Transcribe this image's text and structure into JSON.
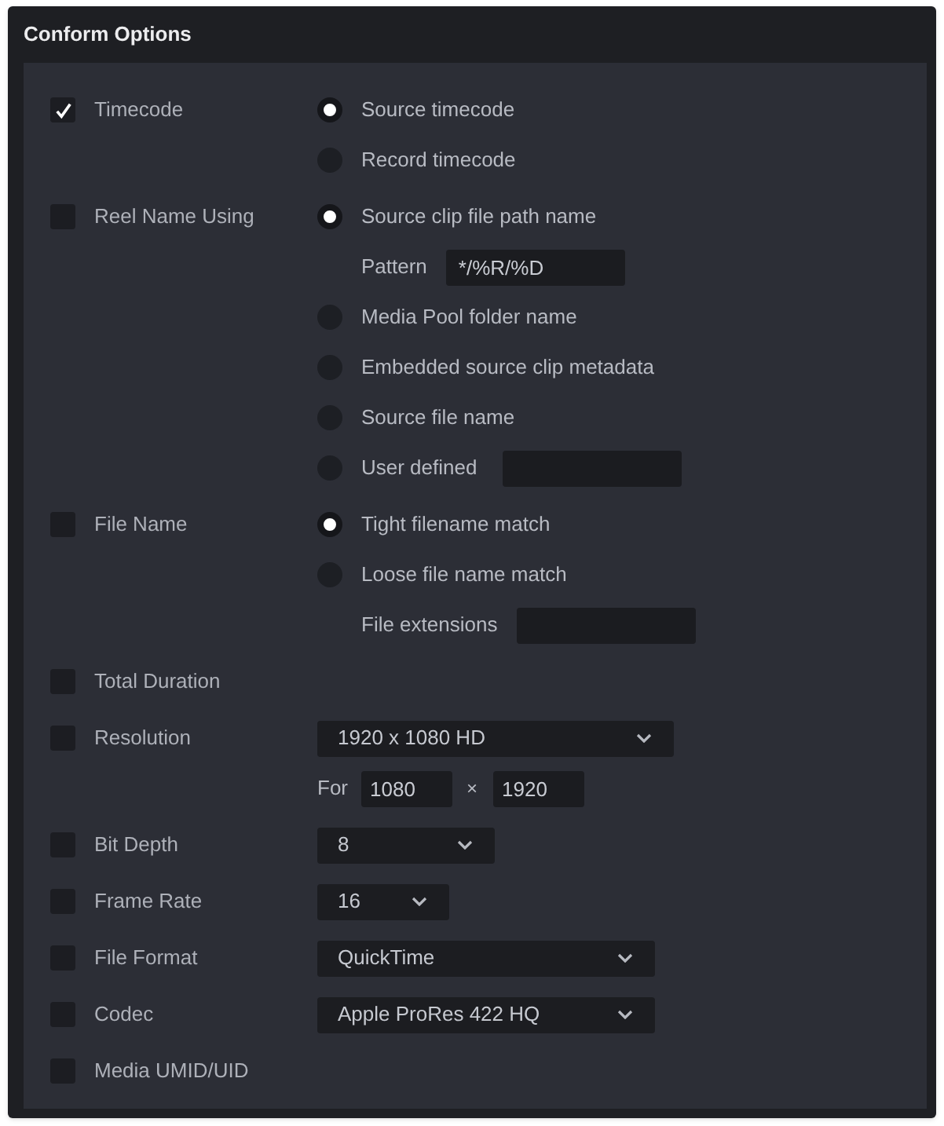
{
  "window": {
    "title": "Conform Options"
  },
  "options": [
    {
      "label": "Timecode",
      "checked": true,
      "controls": [
        {
          "kind": "radio",
          "label": "Source timecode",
          "selected": true
        },
        {
          "kind": "radio",
          "label": "Record timecode",
          "selected": false
        }
      ]
    },
    {
      "label": "Reel Name Using",
      "checked": false,
      "controls": [
        {
          "kind": "radio",
          "label": "Source clip file path name",
          "selected": true
        },
        {
          "kind": "text_field",
          "label": "Pattern",
          "value": "*/%R/%D"
        },
        {
          "kind": "radio",
          "label": "Media Pool folder name",
          "selected": false
        },
        {
          "kind": "radio",
          "label": "Embedded source clip metadata",
          "selected": false
        },
        {
          "kind": "radio",
          "label": "Source file name",
          "selected": false
        },
        {
          "kind": "radio_field",
          "label": "User defined",
          "selected": false
        }
      ]
    },
    {
      "label": "File Name",
      "checked": false,
      "controls": [
        {
          "kind": "radio",
          "label": "Tight filename match",
          "selected": true
        },
        {
          "kind": "radio",
          "label": "Loose file name match",
          "selected": false
        },
        {
          "kind": "text_field",
          "label": "File extensions"
        }
      ]
    },
    {
      "label": "Total Duration",
      "checked": false
    },
    {
      "label": "Resolution",
      "checked": false,
      "controls": [
        {
          "kind": "dropdown",
          "value": "1920 x 1080 HD"
        },
        {
          "kind": "size_fields",
          "label": "For",
          "values": [
            "1080",
            "1920"
          ],
          "separator": "×"
        }
      ]
    },
    {
      "label": "Bit Depth",
      "checked": false,
      "controls": [
        {
          "kind": "dropdown",
          "value": "8"
        }
      ]
    },
    {
      "label": "Frame Rate",
      "checked": false,
      "controls": [
        {
          "kind": "dropdown",
          "value": "16"
        }
      ]
    },
    {
      "label": "File Format",
      "checked": false,
      "controls": [
        {
          "kind": "dropdown",
          "value": "QuickTime"
        }
      ]
    },
    {
      "label": "Codec",
      "checked": false,
      "controls": [
        {
          "kind": "dropdown",
          "value": "Apple ProRes 422 HQ"
        }
      ]
    },
    {
      "label": "Media UMID/UID",
      "checked": false
    }
  ]
}
